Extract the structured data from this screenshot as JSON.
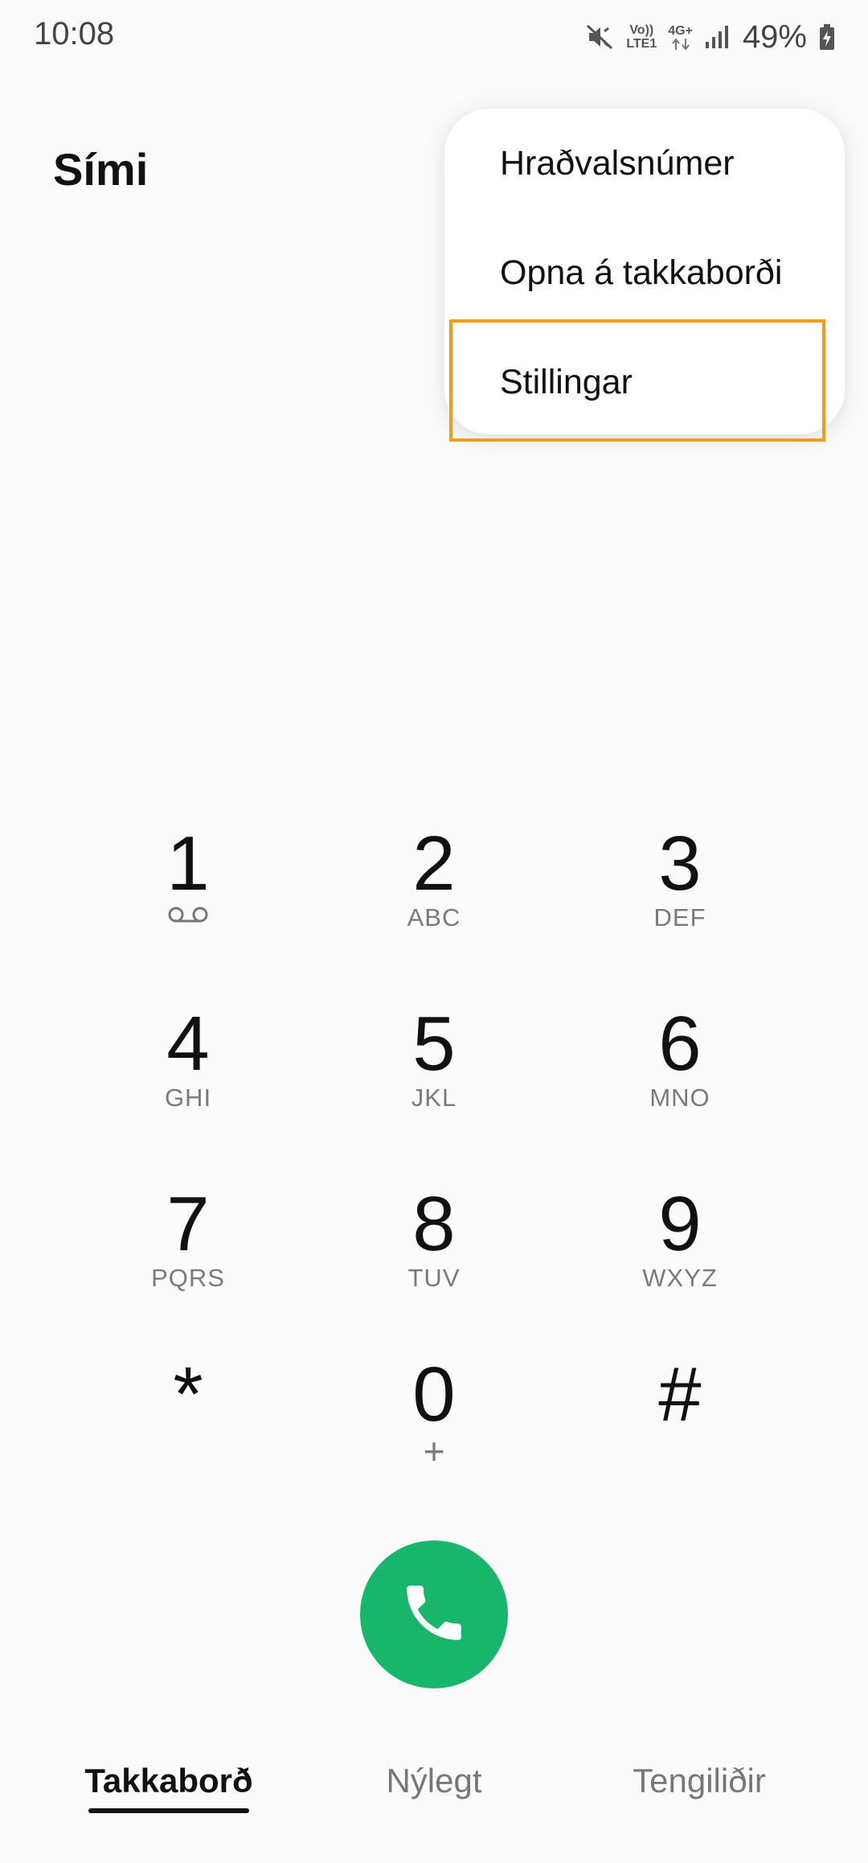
{
  "status_bar": {
    "time": "10:08",
    "volte_top": "Vo))",
    "volte_bottom": "LTE1",
    "network_type": "4G+",
    "battery_percent": "49%",
    "icons": [
      "mute-vibrate-icon",
      "volte-icon",
      "data-arrows-icon",
      "signal-icon",
      "battery-charging-icon"
    ]
  },
  "header": {
    "title": "Sími"
  },
  "overflow_menu": {
    "items": [
      {
        "label": "Hraðvalsnúmer"
      },
      {
        "label": "Opna á takkaborði"
      },
      {
        "label": "Stillingar"
      }
    ],
    "highlight_color": "#f19c1c"
  },
  "dialpad": {
    "keys": [
      {
        "digit": "1",
        "letters": "",
        "icon": "voicemail-icon"
      },
      {
        "digit": "2",
        "letters": "ABC"
      },
      {
        "digit": "3",
        "letters": "DEF"
      },
      {
        "digit": "4",
        "letters": "GHI"
      },
      {
        "digit": "5",
        "letters": "JKL"
      },
      {
        "digit": "6",
        "letters": "MNO"
      },
      {
        "digit": "7",
        "letters": "PQRS"
      },
      {
        "digit": "8",
        "letters": "TUV"
      },
      {
        "digit": "9",
        "letters": "WXYZ"
      },
      {
        "digit": "*",
        "letters": ""
      },
      {
        "digit": "0",
        "letters": "+"
      },
      {
        "digit": "#",
        "letters": ""
      }
    ]
  },
  "call_button": {
    "icon": "phone-icon",
    "color": "#17b66a"
  },
  "bottom_nav": {
    "tabs": [
      {
        "label": "Takkaborð",
        "active": true
      },
      {
        "label": "Nýlegt",
        "active": false
      },
      {
        "label": "Tengiliðir",
        "active": false
      }
    ]
  }
}
